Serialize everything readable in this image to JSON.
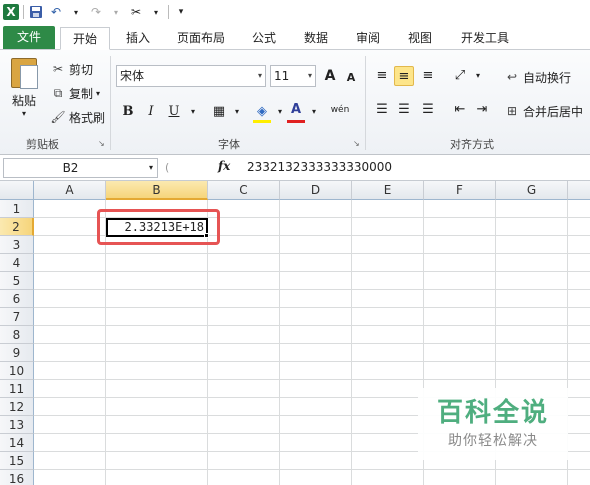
{
  "tabs": [
    "文件",
    "开始",
    "插入",
    "页面布局",
    "公式",
    "数据",
    "审阅",
    "视图",
    "开发工具"
  ],
  "clipboard": {
    "paste": "粘贴",
    "cut": "剪切",
    "copy": "复制",
    "format_painter": "格式刷",
    "group": "剪贴板"
  },
  "font": {
    "name": "宋体",
    "size": "11",
    "group": "字体",
    "grow": "A",
    "shrink": "A",
    "bold": "B",
    "italic": "I",
    "underline": "U",
    "font_color": "A",
    "wen": "wén"
  },
  "alignment": {
    "wrap": "自动换行",
    "merge": "合并后居中",
    "group": "对齐方式"
  },
  "formula_bar": {
    "name_box": "B2",
    "fx": "fx",
    "value": "2332132333333330000"
  },
  "columns": [
    "A",
    "B",
    "C",
    "D",
    "E",
    "F",
    "G"
  ],
  "rows": [
    "1",
    "2",
    "3",
    "4",
    "5",
    "6",
    "7",
    "8",
    "9",
    "10",
    "11",
    "12",
    "13",
    "14",
    "15",
    "16"
  ],
  "cells": {
    "B2": "2.33213E+18"
  },
  "watermark": {
    "title": "百科全说",
    "subtitle": "助你轻松解决"
  }
}
